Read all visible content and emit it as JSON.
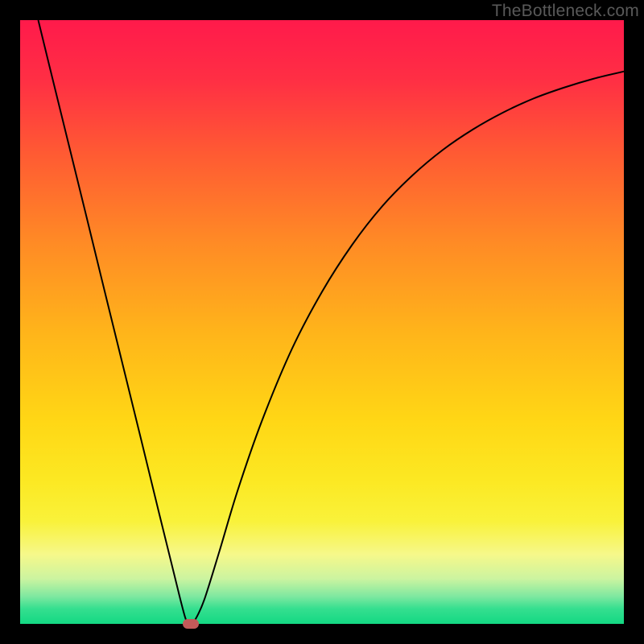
{
  "watermark": "TheBottleneck.com",
  "chart_data": {
    "type": "line",
    "title": "",
    "xlabel": "",
    "ylabel": "",
    "xlim": [
      0,
      100
    ],
    "ylim": [
      0,
      100
    ],
    "grid": false,
    "background_gradient": {
      "stops": [
        {
          "offset": 0.0,
          "color": "#ff1a4b"
        },
        {
          "offset": 0.1,
          "color": "#ff2f44"
        },
        {
          "offset": 0.22,
          "color": "#ff5a33"
        },
        {
          "offset": 0.37,
          "color": "#ff8b25"
        },
        {
          "offset": 0.52,
          "color": "#ffb51a"
        },
        {
          "offset": 0.66,
          "color": "#ffd615"
        },
        {
          "offset": 0.76,
          "color": "#fce822"
        },
        {
          "offset": 0.83,
          "color": "#f9f23a"
        },
        {
          "offset": 0.885,
          "color": "#f6f88a"
        },
        {
          "offset": 0.925,
          "color": "#ccf4a0"
        },
        {
          "offset": 0.955,
          "color": "#7de8a0"
        },
        {
          "offset": 0.975,
          "color": "#35df8f"
        },
        {
          "offset": 1.0,
          "color": "#13d883"
        }
      ]
    },
    "series": [
      {
        "name": "bottleneck-curve",
        "stroke": "#000000",
        "stroke_width": 2,
        "points": [
          {
            "x": 3.0,
            "y": 100.0
          },
          {
            "x": 5.0,
            "y": 91.8
          },
          {
            "x": 8.0,
            "y": 79.6
          },
          {
            "x": 11.0,
            "y": 67.4
          },
          {
            "x": 14.0,
            "y": 55.1
          },
          {
            "x": 17.0,
            "y": 42.9
          },
          {
            "x": 20.0,
            "y": 30.7
          },
          {
            "x": 23.0,
            "y": 18.4
          },
          {
            "x": 25.0,
            "y": 10.3
          },
          {
            "x": 26.5,
            "y": 4.2
          },
          {
            "x": 27.5,
            "y": 0.6
          },
          {
            "x": 28.2,
            "y": 0.0
          },
          {
            "x": 29.0,
            "y": 0.7
          },
          {
            "x": 30.5,
            "y": 4.0
          },
          {
            "x": 33.0,
            "y": 12.0
          },
          {
            "x": 36.0,
            "y": 22.0
          },
          {
            "x": 40.0,
            "y": 33.5
          },
          {
            "x": 45.0,
            "y": 45.5
          },
          {
            "x": 50.0,
            "y": 55.0
          },
          {
            "x": 55.0,
            "y": 62.8
          },
          {
            "x": 60.0,
            "y": 69.2
          },
          {
            "x": 65.0,
            "y": 74.3
          },
          {
            "x": 70.0,
            "y": 78.5
          },
          {
            "x": 75.0,
            "y": 81.9
          },
          {
            "x": 80.0,
            "y": 84.7
          },
          {
            "x": 85.0,
            "y": 87.0
          },
          {
            "x": 90.0,
            "y": 88.8
          },
          {
            "x": 95.0,
            "y": 90.3
          },
          {
            "x": 100.0,
            "y": 91.5
          }
        ]
      }
    ],
    "marker": {
      "name": "optimal-point",
      "x": 28.2,
      "y": 0.0,
      "color": "#c25a59"
    }
  }
}
